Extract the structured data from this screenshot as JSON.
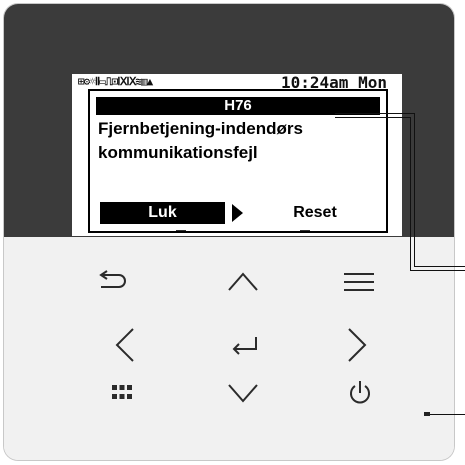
{
  "screen": {
    "status_icons": "⊞⚙☼Ⅱ▭⎍⊡ⅨⅨ≋▥▲",
    "time": "10:24am Mon",
    "dialog": {
      "code": "H76",
      "message_line1": "Fjernbetjening-indendørs",
      "message_line2": "kommunikationsfejl",
      "close_button": "Luk",
      "reset_button": "Reset"
    }
  },
  "keypad": {
    "row1": [
      "back-icon",
      "up-icon",
      "menu-icon"
    ],
    "row2": [
      "left-icon",
      "enter-icon",
      "right-icon"
    ],
    "row3": [
      "grid-icon",
      "down-icon",
      "power-icon"
    ]
  },
  "colors": {
    "top_panel": "#3b3b3b",
    "bottom_panel": "#f1f1f1",
    "lcd_background": "#ffffff",
    "icon_stroke": "#2b2b2b"
  }
}
